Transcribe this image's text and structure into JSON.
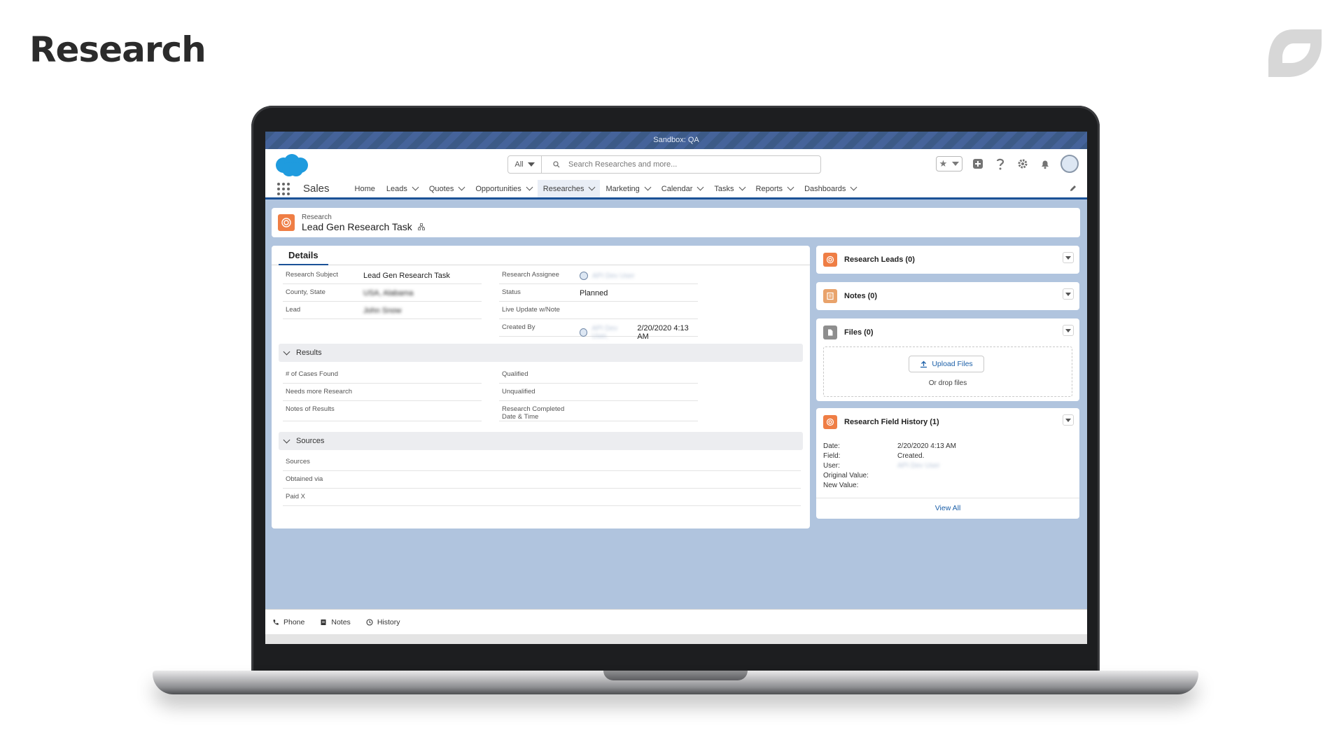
{
  "slide": {
    "title": "Research"
  },
  "app": {
    "sandbox_label": "Sandbox: QA",
    "app_name": "Sales",
    "search": {
      "scope": "All",
      "placeholder": "Search Researches and more..."
    },
    "nav": [
      {
        "label": "Home",
        "dropdown": false
      },
      {
        "label": "Leads",
        "dropdown": true
      },
      {
        "label": "Quotes",
        "dropdown": true
      },
      {
        "label": "Opportunities",
        "dropdown": true
      },
      {
        "label": "Researches",
        "dropdown": true,
        "active": true
      },
      {
        "label": "Marketing",
        "dropdown": true
      },
      {
        "label": "Calendar",
        "dropdown": true
      },
      {
        "label": "Tasks",
        "dropdown": true
      },
      {
        "label": "Reports",
        "dropdown": true
      },
      {
        "label": "Dashboards",
        "dropdown": true
      }
    ],
    "header_icons": [
      "favorites-icon",
      "add-icon",
      "help-icon",
      "setup-gear-icon",
      "notifications-bell-icon",
      "user-avatar"
    ]
  },
  "record": {
    "object_label": "Research",
    "name": "Lead Gen Research Task",
    "details_tab": "Details",
    "fields_left": [
      {
        "label": "Research Subject",
        "value": "Lead Gen Research Task",
        "blurred": false
      },
      {
        "label": "County, State",
        "value": "USA, Alabama",
        "blurred": true
      },
      {
        "label": "Lead",
        "value": "John Snow",
        "blurred": true
      }
    ],
    "fields_right": [
      {
        "label": "Research Assignee",
        "value": "API Dev User",
        "blurred": true,
        "avatar": true
      },
      {
        "label": "Status",
        "value": "Planned",
        "blurred": false
      },
      {
        "label": "Live Update w/Note",
        "value": "",
        "blurred": false
      },
      {
        "label": "Created By",
        "value": "API Dev User,",
        "blurred": true,
        "avatar": true,
        "extra": "2/20/2020 4:13 AM"
      }
    ],
    "results_section": {
      "title": "Results",
      "left": [
        "# of Cases Found",
        "Needs more Research",
        "Notes of Results"
      ],
      "right": [
        "Qualified",
        "Unqualified",
        "Research Completed Date & Time"
      ]
    },
    "sources_section": {
      "title": "Sources",
      "fields": [
        "Sources",
        "Obtained via",
        "Paid X"
      ]
    }
  },
  "related": {
    "research_leads": "Research Leads (0)",
    "notes": "Notes (0)",
    "files": {
      "title": "Files (0)",
      "upload": "Upload Files",
      "drop": "Or drop files"
    },
    "history": {
      "title": "Research Field History (1)",
      "rows": [
        {
          "k": "Date:",
          "v": "2/20/2020 4:13 AM",
          "blurred": false
        },
        {
          "k": "Field:",
          "v": "Created.",
          "blurred": false
        },
        {
          "k": "User:",
          "v": "API Dev User",
          "blurred": true
        },
        {
          "k": "Original Value:",
          "v": "",
          "blurred": false
        },
        {
          "k": "New Value:",
          "v": "",
          "blurred": false
        }
      ],
      "view_all": "View All"
    }
  },
  "utility_bar": [
    "Phone",
    "Notes",
    "History"
  ],
  "colors": {
    "brand_blue": "#1b5297",
    "research_orange": "#ef7e45",
    "page_bg": "#b0c4de"
  }
}
